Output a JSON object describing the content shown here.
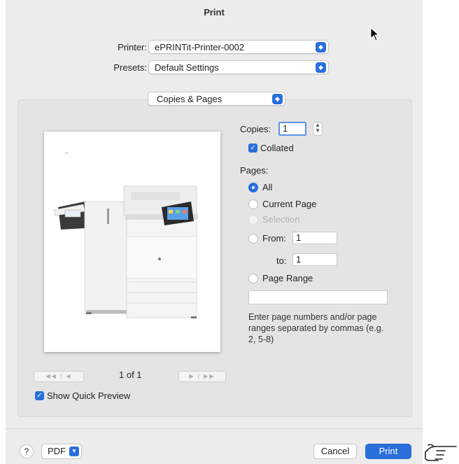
{
  "dialog": {
    "title": "Print"
  },
  "printer": {
    "label": "Printer:",
    "value": "ePRINTit-Printer-0002"
  },
  "presets": {
    "label": "Presets:",
    "value": "Default Settings"
  },
  "section_menu": {
    "value": "Copies & Pages"
  },
  "preview": {
    "page_indicator": "1 of 1",
    "first_prev_glyphs": "◀◀ | ◀",
    "next_last_glyphs": "▶ | ▶▶",
    "show_quick_preview_label": "Show Quick Preview",
    "show_quick_preview_checked": true
  },
  "copies": {
    "label": "Copies:",
    "value": "1",
    "collated_label": "Collated",
    "collated_checked": true
  },
  "pages": {
    "label": "Pages:",
    "all_label": "All",
    "current_page_label": "Current Page",
    "selection_label": "Selection",
    "from_label": "From:",
    "from_value": "1",
    "to_label": "to:",
    "to_value": "1",
    "page_range_label": "Page Range",
    "range_value": "",
    "hint": "Enter page numbers and/or page ranges separated by commas (e.g. 2, 5-8)",
    "selected": "All"
  },
  "footer": {
    "help_label": "?",
    "pdf_label": "PDF",
    "cancel_label": "Cancel",
    "print_label": "Print"
  },
  "colors": {
    "accent": "#2a6fdb",
    "panel": "#e4e4e4",
    "window": "#ececec"
  },
  "icons": [
    "mouse-cursor-icon",
    "hand-pointer-icon",
    "copies-stepper-icon",
    "chevron-updown-icon"
  ]
}
